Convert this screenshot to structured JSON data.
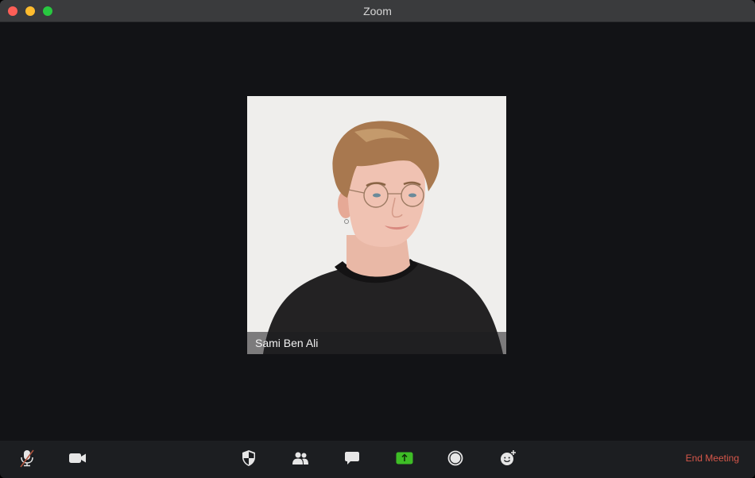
{
  "window": {
    "title": "Zoom",
    "controls": [
      "close",
      "minimize",
      "maximize"
    ]
  },
  "participant": {
    "name": "Sami Ben Ali"
  },
  "toolbar": {
    "buttons": [
      {
        "id": "mute",
        "icon": "microphone-muted-icon",
        "state": "muted"
      },
      {
        "id": "video",
        "icon": "video-camera-icon"
      },
      {
        "id": "security",
        "icon": "shield-icon"
      },
      {
        "id": "participants",
        "icon": "participants-icon"
      },
      {
        "id": "chat",
        "icon": "chat-bubble-icon"
      },
      {
        "id": "share-screen",
        "icon": "share-screen-icon",
        "accent": "#3ebd26"
      },
      {
        "id": "record",
        "icon": "record-icon"
      },
      {
        "id": "reactions",
        "icon": "reaction-emoji-icon"
      }
    ],
    "end_meeting_label": "End Meeting",
    "end_meeting_color": "#d6574a"
  }
}
